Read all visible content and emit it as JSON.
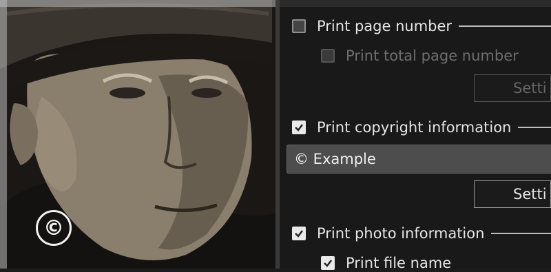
{
  "photo": {
    "copyright_symbol": "©"
  },
  "options": {
    "print_page_number": {
      "label": "Print page number",
      "checked": false
    },
    "print_total_page_number": {
      "label": "Print total page number",
      "checked": false,
      "enabled": false
    },
    "page_setting_button": "Setti",
    "print_copyright": {
      "label": "Print copyright information",
      "checked": true
    },
    "copyright_text": "© Example",
    "copyright_setting_button": "Setti",
    "print_photo_info": {
      "label": "Print photo information",
      "checked": true
    },
    "print_file_name": {
      "label": "Print file name",
      "checked": true
    }
  },
  "colors": {
    "panel_bg": "#191919",
    "field_bg": "#4d4d4d",
    "text": "#e6e6e6",
    "disabled_text": "#6e6e6e"
  }
}
